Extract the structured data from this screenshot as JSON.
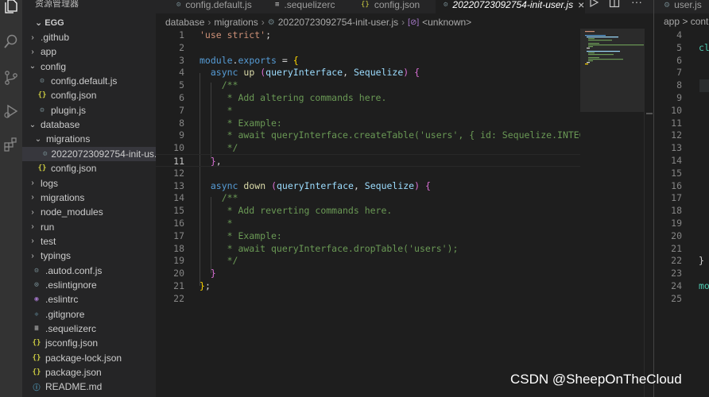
{
  "sidebar": {
    "title": "资源管理器",
    "root": "EGG",
    "items": [
      {
        "label": ".github",
        "kind": "folder",
        "open": false,
        "depth": 1
      },
      {
        "label": "app",
        "kind": "folder",
        "open": false,
        "depth": 1
      },
      {
        "label": "config",
        "kind": "folder",
        "open": true,
        "depth": 1
      },
      {
        "label": "config.default.js",
        "kind": "gear",
        "depth": 2
      },
      {
        "label": "config.json",
        "kind": "json",
        "depth": 2
      },
      {
        "label": "plugin.js",
        "kind": "gear",
        "depth": 2
      },
      {
        "label": "database",
        "kind": "folder",
        "open": true,
        "depth": 1
      },
      {
        "label": "migrations",
        "kind": "folder",
        "open": true,
        "depth": 2
      },
      {
        "label": "20220723092754-init-us...",
        "kind": "gear",
        "depth": 3,
        "selected": true
      },
      {
        "label": "config.json",
        "kind": "json",
        "depth": 2
      },
      {
        "label": "logs",
        "kind": "folder",
        "open": false,
        "depth": 1
      },
      {
        "label": "migrations",
        "kind": "folder",
        "open": false,
        "depth": 1
      },
      {
        "label": "node_modules",
        "kind": "folder",
        "open": false,
        "depth": 1
      },
      {
        "label": "run",
        "kind": "folder",
        "open": false,
        "depth": 1
      },
      {
        "label": "test",
        "kind": "folder",
        "open": false,
        "depth": 1
      },
      {
        "label": "typings",
        "kind": "folder",
        "open": false,
        "depth": 1
      },
      {
        "label": ".autod.conf.js",
        "kind": "gear",
        "depth": 1
      },
      {
        "label": ".eslintignore",
        "kind": "dot",
        "depth": 1
      },
      {
        "label": ".eslintrc",
        "kind": "eslint",
        "depth": 1
      },
      {
        "label": ".gitignore",
        "kind": "git",
        "depth": 1
      },
      {
        "label": ".sequelizerc",
        "kind": "lines",
        "depth": 1
      },
      {
        "label": "jsconfig.json",
        "kind": "json",
        "depth": 1
      },
      {
        "label": "package-lock.json",
        "kind": "json",
        "depth": 1
      },
      {
        "label": "package.json",
        "kind": "json",
        "depth": 1
      },
      {
        "label": "README.md",
        "kind": "info",
        "depth": 1
      }
    ]
  },
  "tabs": [
    {
      "label": "config.default.js",
      "icon": "gear",
      "active": false
    },
    {
      "label": ".sequelizerc",
      "icon": "lines",
      "active": false
    },
    {
      "label": "config.json",
      "icon": "json",
      "active": false
    },
    {
      "label": "20220723092754-init-user.js",
      "icon": "gear",
      "active": true
    }
  ],
  "tab_close": "×",
  "breadcrumb": [
    "database",
    "migrations",
    "20220723092754-init-user.js",
    "<unknown>"
  ],
  "editor": {
    "current_line": 11,
    "lines": [
      {
        "n": "1",
        "tokens": [
          [
            "str",
            "'use strict'"
          ],
          [
            "pl",
            ";"
          ]
        ]
      },
      {
        "n": "2",
        "tokens": []
      },
      {
        "n": "3",
        "tokens": [
          [
            "kw",
            "module"
          ],
          [
            "pl",
            "."
          ],
          [
            "kw",
            "exports"
          ],
          [
            "pl",
            " = "
          ],
          [
            "br",
            "{"
          ]
        ]
      },
      {
        "n": "4",
        "tokens": [
          [
            "pl",
            "  "
          ],
          [
            "kw",
            "async"
          ],
          [
            "pl",
            " "
          ],
          [
            "fn",
            "up"
          ],
          [
            "pl",
            " "
          ],
          [
            "br2",
            "("
          ],
          [
            "var",
            "queryInterface"
          ],
          [
            "pl",
            ", "
          ],
          [
            "var",
            "Sequelize"
          ],
          [
            "br2",
            ")"
          ],
          [
            "pl",
            " "
          ],
          [
            "br2",
            "{"
          ]
        ]
      },
      {
        "n": "5",
        "tokens": [
          [
            "cmt",
            "    /**"
          ]
        ]
      },
      {
        "n": "6",
        "tokens": [
          [
            "cmt",
            "     * Add altering commands here."
          ]
        ]
      },
      {
        "n": "7",
        "tokens": [
          [
            "cmt",
            "     *"
          ]
        ]
      },
      {
        "n": "8",
        "tokens": [
          [
            "cmt",
            "     * Example:"
          ]
        ]
      },
      {
        "n": "9",
        "tokens": [
          [
            "cmt",
            "     * await queryInterface.createTable('users', { id: Sequelize.INTEGER });"
          ]
        ]
      },
      {
        "n": "10",
        "tokens": [
          [
            "cmt",
            "     */"
          ]
        ]
      },
      {
        "n": "11",
        "tokens": [
          [
            "pl",
            "  "
          ],
          [
            "br2",
            "}"
          ],
          [
            "pl",
            ","
          ]
        ]
      },
      {
        "n": "12",
        "tokens": []
      },
      {
        "n": "13",
        "tokens": [
          [
            "pl",
            "  "
          ],
          [
            "kw",
            "async"
          ],
          [
            "pl",
            " "
          ],
          [
            "fn",
            "down"
          ],
          [
            "pl",
            " "
          ],
          [
            "br2",
            "("
          ],
          [
            "var",
            "queryInterface"
          ],
          [
            "pl",
            ", "
          ],
          [
            "var",
            "Sequelize"
          ],
          [
            "br2",
            ")"
          ],
          [
            "pl",
            " "
          ],
          [
            "br2",
            "{"
          ]
        ]
      },
      {
        "n": "14",
        "tokens": [
          [
            "cmt",
            "    /**"
          ]
        ]
      },
      {
        "n": "15",
        "tokens": [
          [
            "cmt",
            "     * Add reverting commands here."
          ]
        ]
      },
      {
        "n": "16",
        "tokens": [
          [
            "cmt",
            "     *"
          ]
        ]
      },
      {
        "n": "17",
        "tokens": [
          [
            "cmt",
            "     * Example:"
          ]
        ]
      },
      {
        "n": "18",
        "tokens": [
          [
            "cmt",
            "     * await queryInterface.dropTable('users');"
          ]
        ]
      },
      {
        "n": "19",
        "tokens": [
          [
            "cmt",
            "     */"
          ]
        ]
      },
      {
        "n": "20",
        "tokens": [
          [
            "pl",
            "  "
          ],
          [
            "br2",
            "}"
          ]
        ]
      },
      {
        "n": "21",
        "tokens": [
          [
            "br",
            "}"
          ],
          [
            "pl",
            ";"
          ]
        ]
      },
      {
        "n": "22",
        "tokens": []
      }
    ]
  },
  "right_pane": {
    "tab_label": "user.js",
    "breadcrumb": "app > contr",
    "lines": [
      {
        "n": "4",
        "text": ""
      },
      {
        "n": "5",
        "text": "cl",
        "cls": true
      },
      {
        "n": "6",
        "text": ""
      },
      {
        "n": "7",
        "text": ""
      },
      {
        "n": "8",
        "text": ""
      },
      {
        "n": "9",
        "text": ""
      },
      {
        "n": "10",
        "text": ""
      },
      {
        "n": "11",
        "text": ""
      },
      {
        "n": "12",
        "text": ""
      },
      {
        "n": "13",
        "text": ""
      },
      {
        "n": "14",
        "text": ""
      },
      {
        "n": "15",
        "text": ""
      },
      {
        "n": "16",
        "text": ""
      },
      {
        "n": "17",
        "text": ""
      },
      {
        "n": "18",
        "text": ""
      },
      {
        "n": "19",
        "text": ""
      },
      {
        "n": "20",
        "text": ""
      },
      {
        "n": "21",
        "text": ""
      },
      {
        "n": "22",
        "text": "}"
      },
      {
        "n": "23",
        "text": ""
      },
      {
        "n": "24",
        "text": "mo",
        "cls": true
      },
      {
        "n": "25",
        "text": ""
      }
    ]
  },
  "watermark": "CSDN @SheepOnTheCloud",
  "colors": {
    "activity_bar": "#333333",
    "sidebar": "#252526",
    "editor_bg": "#1e1e1e",
    "comment": "#6a9955",
    "keyword": "#569cd6",
    "string": "#ce9178"
  }
}
